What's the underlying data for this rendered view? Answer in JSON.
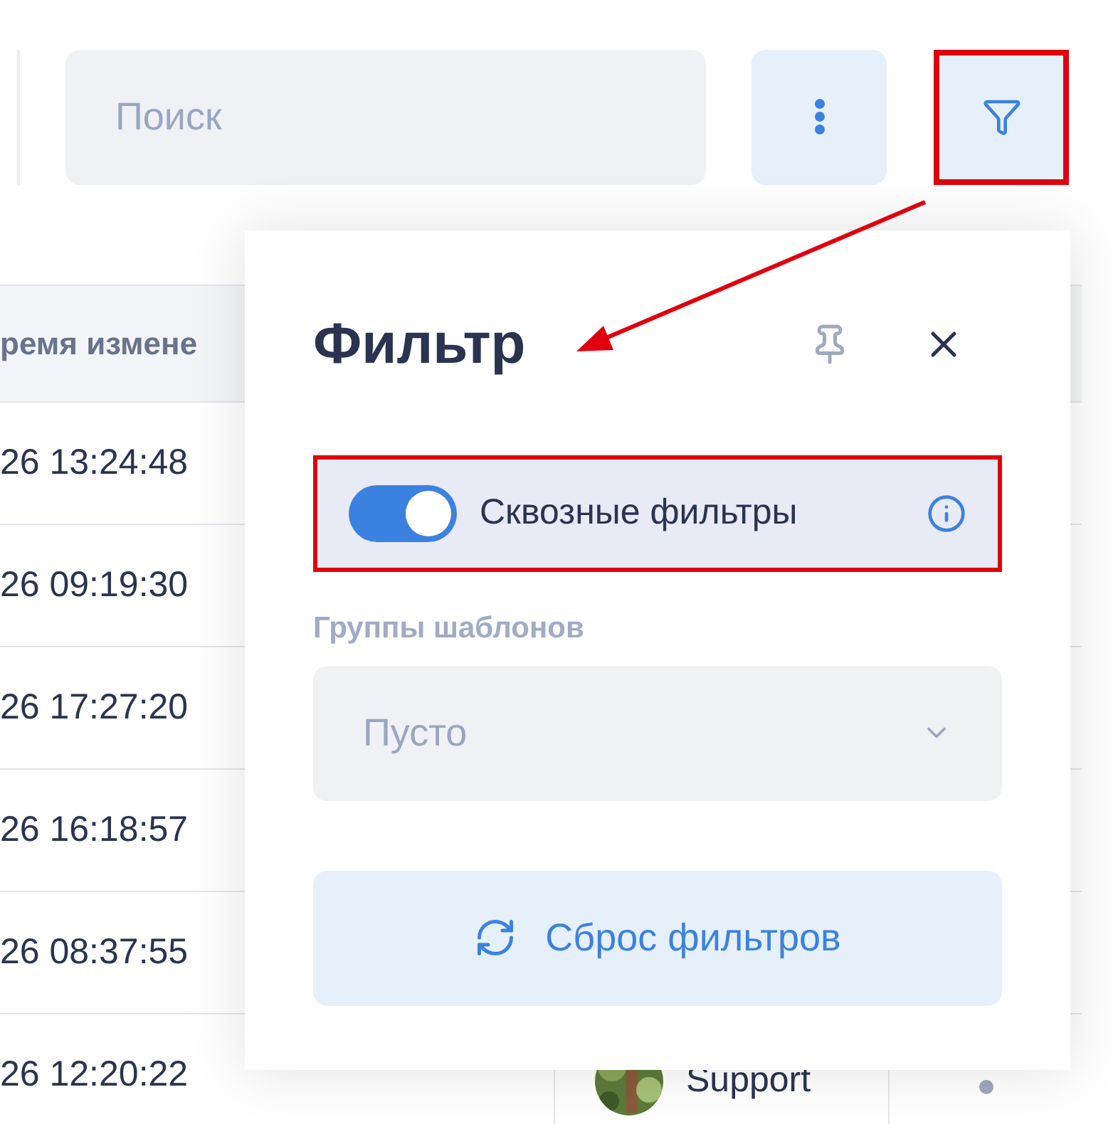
{
  "toolbar": {
    "search": {
      "placeholder": "Поиск"
    }
  },
  "table": {
    "columns": [
      "ремя измене"
    ],
    "rows": [
      {
        "time": "26 13:24:48"
      },
      {
        "time": "26 09:19:30"
      },
      {
        "time": "26 17:27:20"
      },
      {
        "time": "26 16:18:57"
      },
      {
        "time": "26 08:37:55"
      },
      {
        "time": "26 12:20:22",
        "user": "Support"
      }
    ]
  },
  "filter_panel": {
    "title": "Фильтр",
    "through_filters": {
      "label": "Сквозные фильтры",
      "on": true
    },
    "template_groups": {
      "label": "Группы шаблонов",
      "placeholder": "Пусто"
    },
    "reset_button": "Сброс фильтров"
  }
}
